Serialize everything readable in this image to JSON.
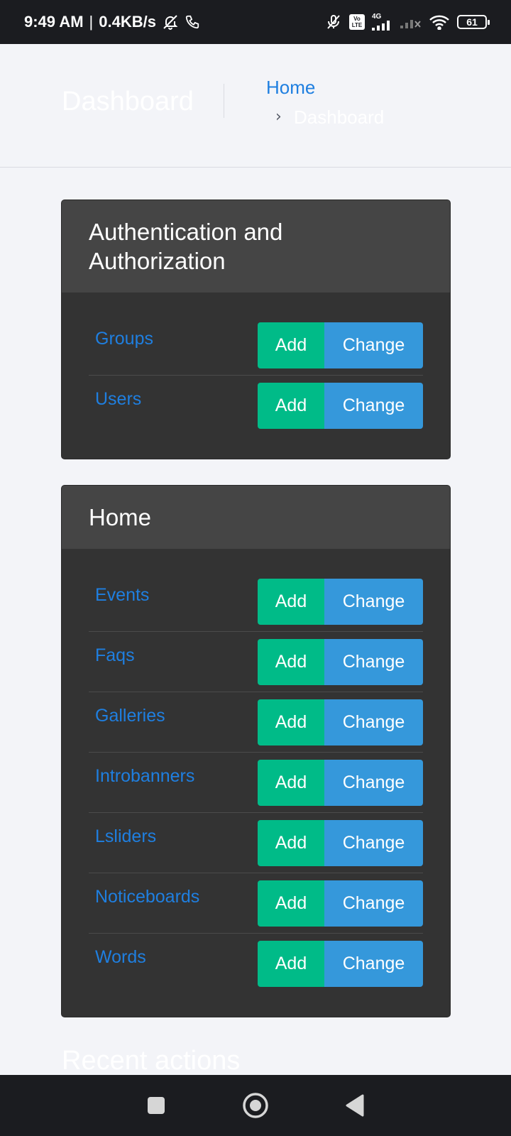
{
  "status_bar": {
    "time": "9:49 AM",
    "separator": "|",
    "speed": "0.4KB/s",
    "network_type": "4G",
    "lte_top": "Vo",
    "lte_bottom": "LTE",
    "battery": "61"
  },
  "header": {
    "title": "Dashboard",
    "breadcrumb_home": "Home",
    "breadcrumb_separator": "›",
    "breadcrumb_current": "Dashboard"
  },
  "modules": [
    {
      "title": "Authentication and Authorization",
      "models": [
        {
          "name": "Groups",
          "add": "Add",
          "change": "Change"
        },
        {
          "name": "Users",
          "add": "Add",
          "change": "Change"
        }
      ]
    },
    {
      "title": "Home",
      "models": [
        {
          "name": "Events",
          "add": "Add",
          "change": "Change"
        },
        {
          "name": "Faqs",
          "add": "Add",
          "change": "Change"
        },
        {
          "name": "Galleries",
          "add": "Add",
          "change": "Change"
        },
        {
          "name": "Introbanners",
          "add": "Add",
          "change": "Change"
        },
        {
          "name": "Lsliders",
          "add": "Add",
          "change": "Change"
        },
        {
          "name": "Noticeboards",
          "add": "Add",
          "change": "Change"
        },
        {
          "name": "Words",
          "add": "Add",
          "change": "Change"
        }
      ]
    }
  ],
  "recent_actions": {
    "title": "Recent actions"
  },
  "nav_bar": {
    "icons": [
      "recents-square-icon",
      "home-circle-icon",
      "back-triangle-icon"
    ]
  },
  "colors": {
    "link": "#1f7fe0",
    "add_button": "#00bb88",
    "change_button": "#3598db",
    "module_header": "#454545",
    "module_body": "#333333",
    "page_background": "#f3f4f8"
  }
}
